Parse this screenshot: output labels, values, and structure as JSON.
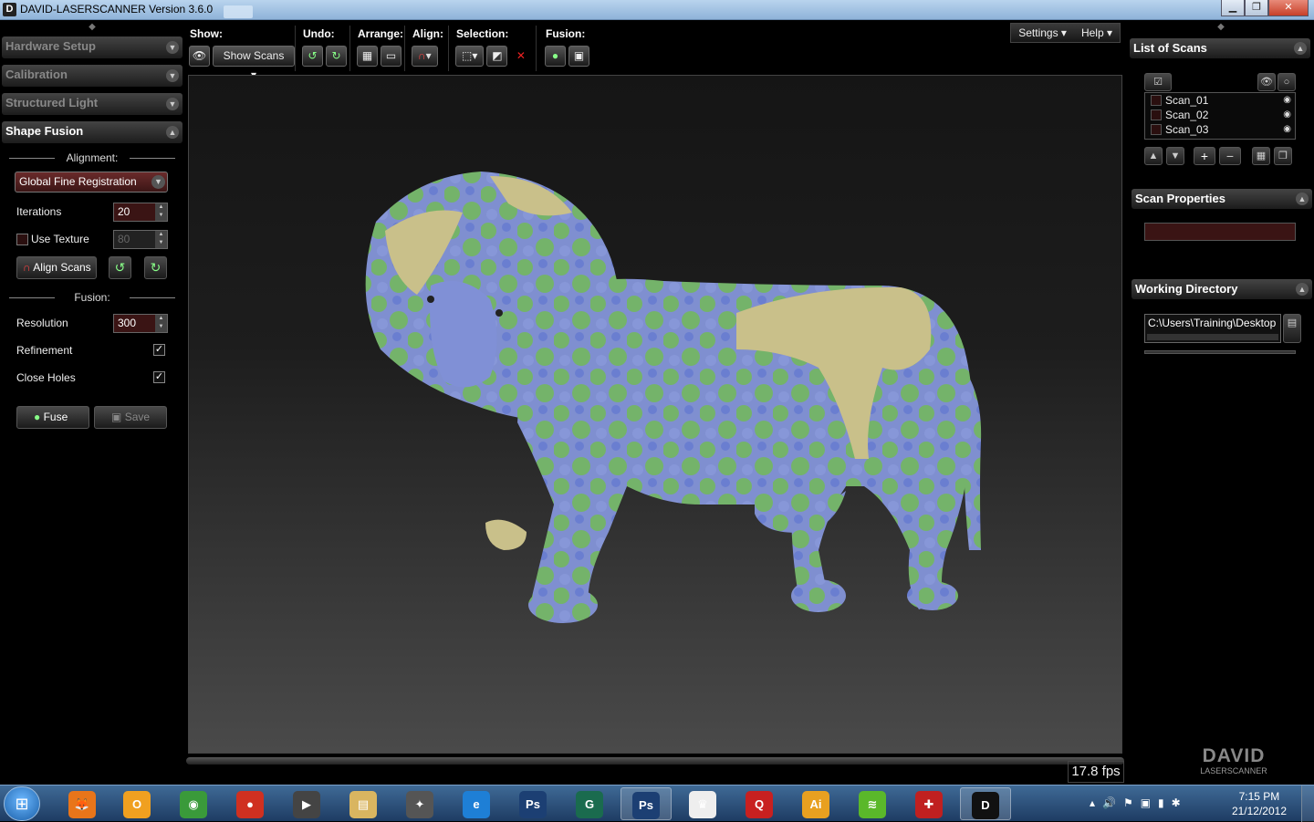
{
  "window": {
    "title": "DAVID-LASERSCANNER Version 3.6.0",
    "minimize": "▁",
    "maximize": "❐",
    "close": "✕"
  },
  "left_panel": {
    "sections": {
      "hardware_setup": "Hardware Setup",
      "calibration": "Calibration",
      "structured_light": "Structured Light",
      "shape_fusion": "Shape Fusion"
    },
    "alignment_label": "Alignment:",
    "alignment_mode": "Global Fine Registration",
    "iterations_label": "Iterations",
    "iterations_value": "20",
    "use_texture_label": "Use Texture",
    "use_texture_value": "80",
    "align_scans_label": "Align Scans",
    "fusion_label": "Fusion:",
    "resolution_label": "Resolution",
    "resolution_value": "300",
    "refinement_label": "Refinement",
    "close_holes_label": "Close Holes",
    "fuse_label": "Fuse",
    "save_label": "Save"
  },
  "toolbar": {
    "show_label": "Show:",
    "show_value": "Show Scans",
    "undo_label": "Undo:",
    "arrange_label": "Arrange:",
    "align_label": "Align:",
    "selection_label": "Selection:",
    "fusion_label": "Fusion:",
    "settings_menu": "Settings ▾",
    "help_menu": "Help ▾"
  },
  "status": {
    "fps": "17.8 fps"
  },
  "right_panel": {
    "list_of_scans": "List of Scans",
    "scans": [
      {
        "name": "Scan_01"
      },
      {
        "name": "Scan_02"
      },
      {
        "name": "Scan_03"
      }
    ],
    "scan_properties": "Scan Properties",
    "working_directory": "Working Directory",
    "directory_path": "C:\\Users\\Training\\Desktop"
  },
  "logo": {
    "brand": "DAVID",
    "sub": "LASERSCANNER"
  },
  "taskbar": {
    "time": "7:15 PM",
    "date": "21/12/2012",
    "apps": [
      {
        "name": "firefox",
        "glyph": "🦊",
        "color": "#e8751a"
      },
      {
        "name": "outlook",
        "glyph": "O",
        "color": "#f0a020"
      },
      {
        "name": "globe",
        "glyph": "◉",
        "color": "#3a9a3a"
      },
      {
        "name": "ball",
        "glyph": "●",
        "color": "#d03020"
      },
      {
        "name": "media",
        "glyph": "▶",
        "color": "#444"
      },
      {
        "name": "explorer",
        "glyph": "▤",
        "color": "#d9b560"
      },
      {
        "name": "tool",
        "glyph": "✦",
        "color": "#555"
      },
      {
        "name": "ie",
        "glyph": "e",
        "color": "#1e7fd6"
      },
      {
        "name": "photoshop",
        "glyph": "Ps",
        "color": "#1c3f73"
      },
      {
        "name": "app-g",
        "glyph": "G",
        "color": "#1a6b4e"
      },
      {
        "name": "photoshop-2",
        "glyph": "Ps",
        "color": "#1c3f73"
      },
      {
        "name": "crown",
        "glyph": "♛",
        "color": "#eee"
      },
      {
        "name": "search-app",
        "glyph": "Q",
        "color": "#c82020"
      },
      {
        "name": "illustrator",
        "glyph": "Ai",
        "color": "#e8a020"
      },
      {
        "name": "spotify",
        "glyph": "≋",
        "color": "#5ab82a"
      },
      {
        "name": "figure",
        "glyph": "✚",
        "color": "#c02020"
      },
      {
        "name": "david",
        "glyph": "D",
        "color": "#111"
      }
    ]
  }
}
